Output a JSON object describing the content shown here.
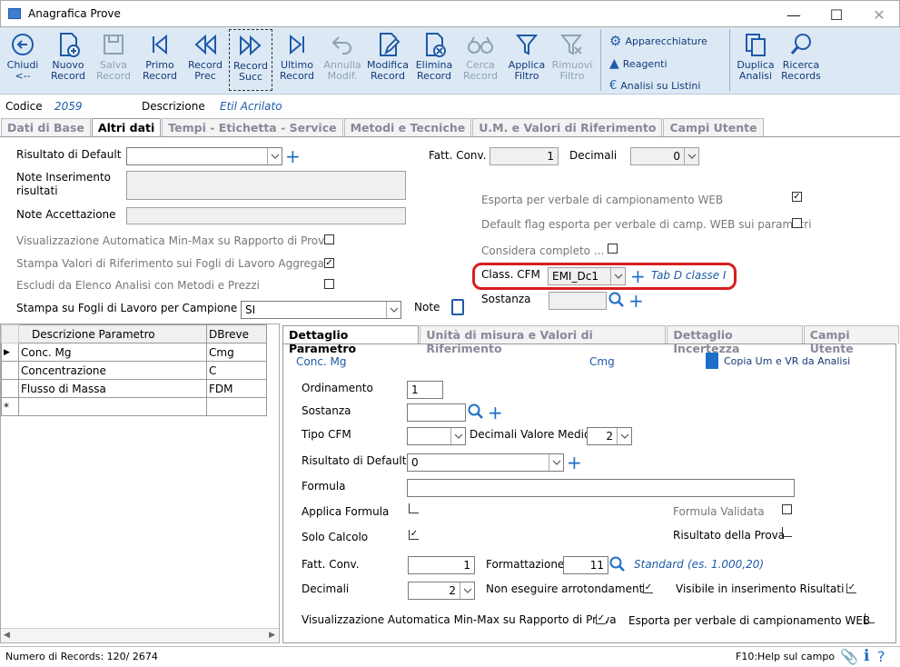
{
  "window": {
    "title": "Anagrafica Prove"
  },
  "toolbar": [
    {
      "l1": "Chiudi",
      "l2": "<--",
      "icon": "back-icon"
    },
    {
      "l1": "Nuovo",
      "l2": "Record",
      "icon": "new-record-icon"
    },
    {
      "l1": "Salva",
      "l2": "Record",
      "icon": "save-icon"
    },
    {
      "l1": "Primo",
      "l2": "Record",
      "icon": "first-icon"
    },
    {
      "l1": "Record",
      "l2": "Prec",
      "icon": "prev-icon"
    },
    {
      "l1": "Record",
      "l2": "Succ",
      "icon": "next-icon"
    },
    {
      "l1": "Ultimo",
      "l2": "Record",
      "icon": "last-icon"
    },
    {
      "l1": "Annulla",
      "l2": "Modif.",
      "icon": "undo-icon"
    },
    {
      "l1": "Modifica",
      "l2": "Record",
      "icon": "edit-icon"
    },
    {
      "l1": "Elimina",
      "l2": "Record",
      "icon": "delete-icon"
    },
    {
      "l1": "Cerca",
      "l2": "Record",
      "icon": "binoculars-icon"
    },
    {
      "l1": "Applica",
      "l2": "Filtro",
      "icon": "filter-icon"
    },
    {
      "l1": "Rimuovi",
      "l2": "Filtro",
      "icon": "remove-filter-icon"
    }
  ],
  "side_menu": [
    "Apparecchiature",
    "Reagenti",
    "Analisi su Listini"
  ],
  "right_buttons": [
    {
      "l1": "Duplica",
      "l2": "Analisi"
    },
    {
      "l1": "Ricerca",
      "l2": "Records"
    }
  ],
  "header": {
    "codice_label": "Codice",
    "codice": "2059",
    "descr_label": "Descrizione",
    "descr": "Etil Acrilato"
  },
  "tabs": [
    "Dati di Base",
    "Altri dati",
    "Tempi - Etichetta - Service",
    "Metodi e Tecniche",
    "U.M. e Valori di Riferimento",
    "Campi Utente"
  ],
  "form": {
    "risultato_default": "Risultato di Default",
    "note_ins_1": "Note Inserimento",
    "note_ins_2": "risultati",
    "note_acc": "Note Accettazione",
    "vis_auto": "Visualizzazione Automatica Min-Max su Rapporto di Prova",
    "stampa_valori": "Stampa Valori di Riferimento sui Fogli di Lavoro Aggregati",
    "escludi": "Escludi da Elenco Analisi con Metodi e Prezzi",
    "stampa_fogli": "Stampa su Fogli di Lavoro per Campione",
    "stampa_fogli_val": "SI",
    "note": "Note",
    "fatt_conv": "Fatt. Conv.",
    "fatt_conv_val": "1",
    "decimali": "Decimali",
    "decimali_val": "0",
    "esporta": "Esporta per verbale di campionamento WEB",
    "default_flag": "Default flag esporta per verbale di camp. WEB sui parametri",
    "considera": "Considera completo ...",
    "class_cfm": "Class. CFM",
    "class_cfm_val": "EMI_Dc1",
    "class_cfm_desc": "Tab D classe I",
    "sostanza": "Sostanza"
  },
  "param_grid": {
    "headers": [
      "Descrizione Parametro",
      "DBreve"
    ],
    "rows": [
      [
        "Conc. Mg",
        "Cmg"
      ],
      [
        "Concentrazione",
        "C"
      ],
      [
        "Flusso di Massa",
        "FDM"
      ]
    ]
  },
  "detail_tabs": [
    "Dettaglio Parametro",
    "Unità di misura e Valori di Riferimento",
    "Dettaglio Incertezza",
    "Campi Utente"
  ],
  "detail": {
    "name": "Conc. Mg",
    "short": "Cmg",
    "copy": "Copia Um e VR da Analisi",
    "ordinamento": "Ordinamento",
    "ordinamento_val": "1",
    "sostanza": "Sostanza",
    "tipo_cfm": "Tipo CFM",
    "dec_medio": "Decimali Valore Medio",
    "dec_medio_val": "2",
    "ris_default": "Risultato di Default",
    "ris_default_val": "0",
    "formula": "Formula",
    "applica_formula": "Applica Formula",
    "formula_validata": "Formula Validata",
    "solo_calcolo": "Solo Calcolo",
    "ris_prova": "Risultato della Prova",
    "fatt_conv": "Fatt. Conv.",
    "fatt_conv_val": "1",
    "formattazione": "Formattazione",
    "formattazione_val": "11",
    "standard": "Standard",
    "standard_ex": "(es. 1.000,20)",
    "decimali": "Decimali",
    "decimali_val": "2",
    "non_arr": "Non eseguire arrotondamenti",
    "visibile": "Visibile in inserimento Risultati",
    "vis_auto": "Visualizzazione Automatica Min-Max su Rapporto di Prova",
    "esporta": "Esporta per verbale di campionamento WEB"
  },
  "status": {
    "records": "Numero di Records: 120/ 2674",
    "help": "F10:Help sul campo"
  }
}
